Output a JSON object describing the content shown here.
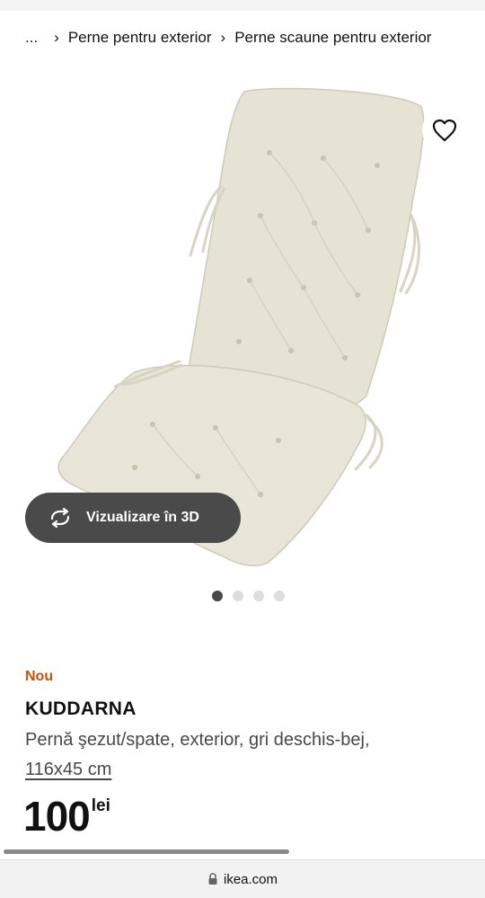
{
  "breadcrumb": {
    "ellipsis": "...",
    "items": [
      {
        "label": "Perne pentru exterior"
      },
      {
        "label": "Perne scaune pentru exterior"
      }
    ]
  },
  "gallery": {
    "image_alt": "KUDDARNA cushion",
    "view3d_label": "Vizualizare în 3D",
    "view3d_icon": "rotate-3d-icon",
    "favorite_icon": "heart-outline-icon",
    "dot_count": 4,
    "active_dot": 1
  },
  "product": {
    "badge": "Nou",
    "name": "KUDDARNA",
    "description": "Pernă şezut/spate, exterior, gri deschis-bej,",
    "size": "116x45 cm",
    "price": "100",
    "currency": "lei"
  },
  "browser": {
    "url": "ikea.com",
    "lock_icon": "lock-icon"
  },
  "colors": {
    "badge": "#ca5008",
    "button_dark": "#4a4a4a",
    "cushion": "#e4e0d2"
  }
}
